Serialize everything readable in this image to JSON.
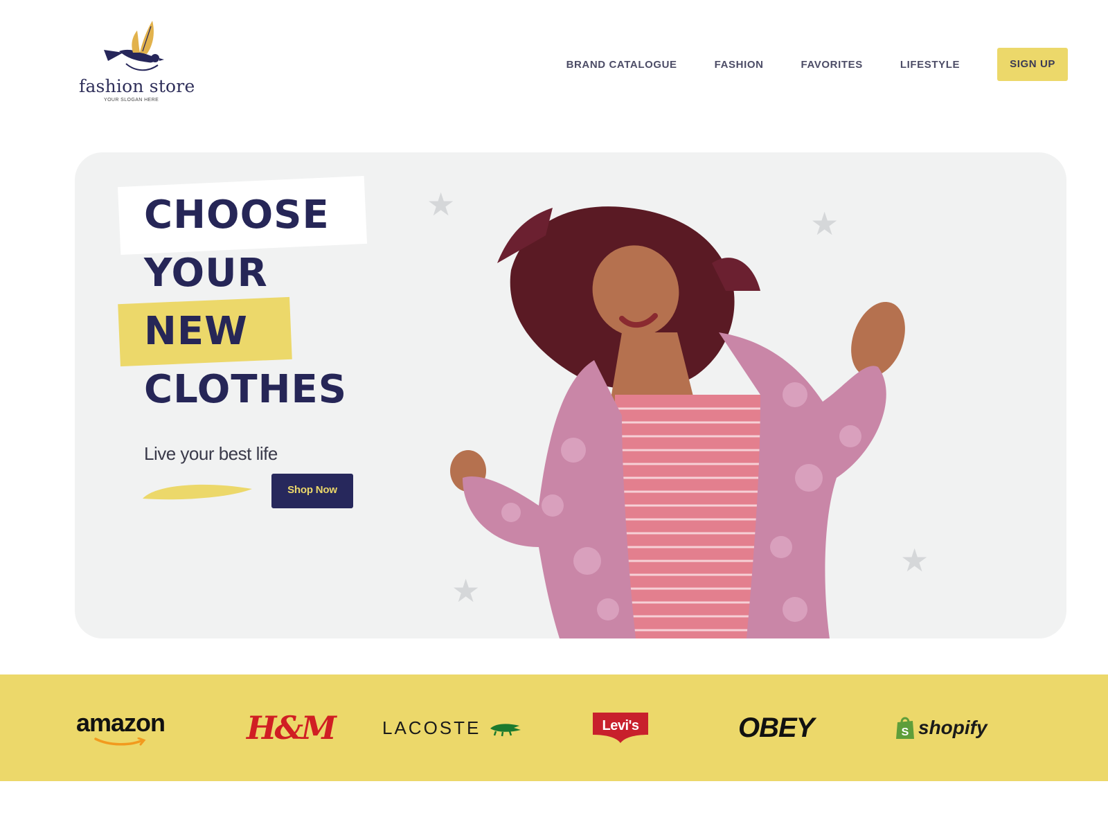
{
  "header": {
    "brand_name": "fashion store",
    "slogan": "YOUR SLOGAN HERE",
    "nav": [
      {
        "label": "BRAND CATALOGUE"
      },
      {
        "label": "FASHION"
      },
      {
        "label": "FAVORITES"
      },
      {
        "label": "LIFESTYLE"
      }
    ],
    "signup_label": "SIGN UP"
  },
  "hero": {
    "headline": [
      "CHOOSE",
      "YOUR",
      "NEW",
      "CLOTHES"
    ],
    "tagline": "Live your best life",
    "cta_label": "Shop Now",
    "image": "woman-in-pink-fur-coat-dancing"
  },
  "brands": [
    {
      "name": "amazon",
      "label": "amazon"
    },
    {
      "name": "hm",
      "label": "H&M"
    },
    {
      "name": "lacoste",
      "label": "LACOSTE"
    },
    {
      "name": "levis",
      "label": "Levi's"
    },
    {
      "name": "obey",
      "label": "OBEY"
    },
    {
      "name": "shopify",
      "label": "shopify"
    }
  ],
  "colors": {
    "navy": "#262657",
    "yellow": "#ecd86a",
    "hero_bg": "#f1f2f2",
    "white": "#ffffff"
  }
}
